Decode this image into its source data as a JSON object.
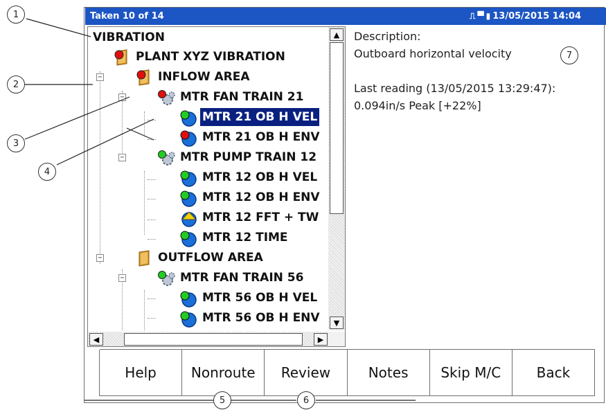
{
  "titlebar": {
    "title": "Taken 10 of 14",
    "datetime": "13/05/2015 14:04",
    "status_icons": [
      "connection-icon",
      "memory-card-icon",
      "battery-icon"
    ]
  },
  "tree": {
    "nodes": [
      {
        "label": "VIBRATION",
        "icon": "none",
        "selected": false
      },
      {
        "label": "PLANT XYZ VIBRATION",
        "icon": "red-flag-building-icon",
        "selected": false
      },
      {
        "label": "INFLOW AREA",
        "icon": "red-flag-area-icon",
        "expander": "−",
        "selected": false
      },
      {
        "label": "MTR FAN TRAIN 21",
        "icon": "red-flag-machine-icon",
        "expander": "−",
        "selected": false
      },
      {
        "label": "MTR 21 OB H VEL",
        "icon": "green-measurement-icon",
        "selected": true
      },
      {
        "label": "MTR 21 OB H ENV",
        "icon": "red-measurement-icon",
        "selected": false
      },
      {
        "label": "MTR PUMP TRAIN 12",
        "icon": "green-flag-machine-icon",
        "expander": "−",
        "selected": false
      },
      {
        "label": "MTR 12 OB H VEL",
        "icon": "green-measurement-icon",
        "selected": false
      },
      {
        "label": "MTR 12 OB H ENV",
        "icon": "green-measurement-icon",
        "selected": false
      },
      {
        "label": "MTR 12 FFT + TW",
        "icon": "yellow-measurement-icon",
        "selected": false
      },
      {
        "label": "MTR 12 TIME",
        "icon": "green-measurement-icon",
        "selected": false
      },
      {
        "label": "OUTFLOW AREA",
        "icon": "area-icon",
        "expander": "−",
        "selected": false
      },
      {
        "label": "MTR FAN TRAIN 56",
        "icon": "green-flag-machine-icon",
        "expander": "−",
        "selected": false
      },
      {
        "label": "MTR 56 OB H VEL",
        "icon": "green-measurement-icon",
        "selected": false
      },
      {
        "label": "MTR 56 OB H ENV",
        "icon": "green-measurement-icon",
        "selected": false
      }
    ]
  },
  "description": {
    "label": "Description:",
    "value": "Outboard horizontal velocity",
    "last_reading_label": "Last reading (13/05/2015 13:29:47):",
    "last_reading_value": "0.094in/s Peak [+22%]"
  },
  "buttons": [
    "Help",
    "Nonroute",
    "Review",
    "Notes",
    "Skip M/C",
    "Back"
  ],
  "callouts": [
    "1",
    "2",
    "3",
    "4",
    "5",
    "6",
    "7"
  ],
  "colors": {
    "titlebar": "#1c55c4",
    "selection": "#0a2080",
    "alarm_red": "#e01010",
    "ok_green": "#22cc22",
    "warn_yellow": "#f0d000",
    "measurement_blue": "#1a6fd8",
    "folder_orange": "#d89a2a"
  }
}
